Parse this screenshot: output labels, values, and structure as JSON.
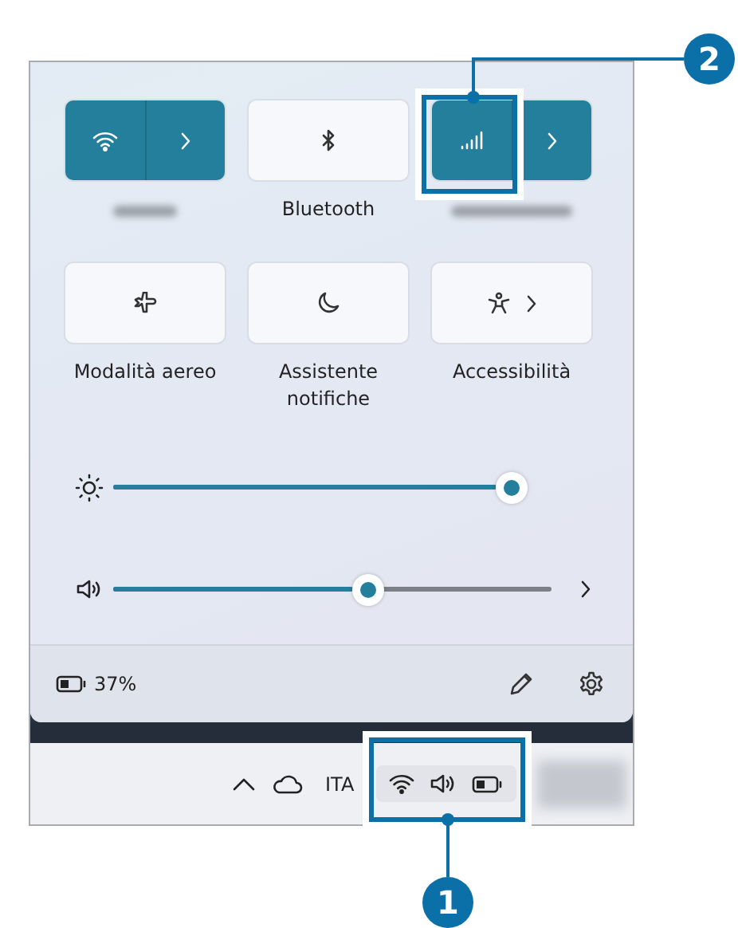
{
  "tiles": [
    {
      "kind": "split",
      "on": true
    },
    {
      "kind": "single",
      "on": false,
      "label": "Bluetooth"
    },
    {
      "kind": "split",
      "on": true
    },
    {
      "kind": "single",
      "on": false,
      "label": "Modalità aereo"
    },
    {
      "kind": "single",
      "on": false,
      "label": "Assistente notifiche"
    },
    {
      "kind": "more",
      "on": false,
      "label": "Accessibilità"
    }
  ],
  "sliders": [
    {
      "kind": "brightness",
      "level": 1.0
    },
    {
      "kind": "volume",
      "level": 0.58
    }
  ],
  "footer": {
    "battery": "37%"
  },
  "taskbar": {
    "language": "ITA"
  },
  "callouts": [
    {
      "number": "2"
    },
    {
      "number": "1"
    }
  ]
}
